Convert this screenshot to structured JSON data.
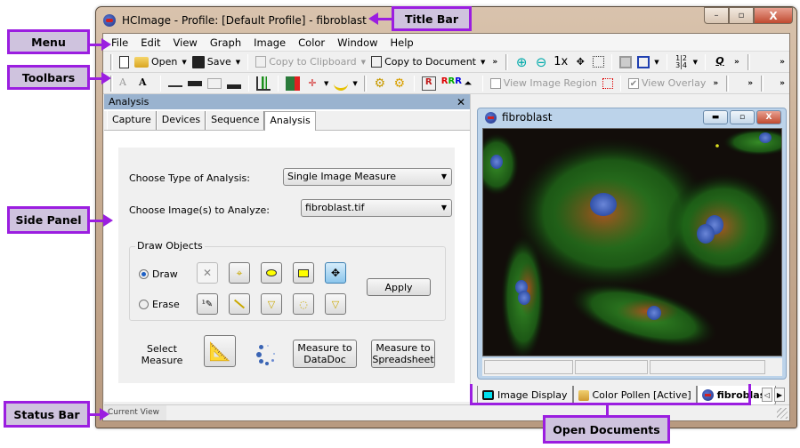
{
  "window": {
    "title": "HCImage - Profile: [Default Profile] - fibroblast",
    "controls": {
      "minimize": "–",
      "maximize": "▫",
      "close": "X"
    }
  },
  "menu": [
    "File",
    "Edit",
    "View",
    "Graph",
    "Image",
    "Color",
    "Window",
    "Help"
  ],
  "toolbar1": {
    "open": "Open",
    "save": "Save",
    "copy_clipboard": "Copy to Clipboard",
    "copy_document": "Copy to Document",
    "zoom_1x": "1x",
    "more": "»"
  },
  "toolbar2": {
    "view_image_region": "View Image Region",
    "view_image_region_checked": false,
    "view_overlay": "View Overlay",
    "view_overlay_checked": true,
    "more": "»"
  },
  "side_panel": {
    "title": "Analysis",
    "close": "✕",
    "tabs": [
      "Capture",
      "Devices",
      "Sequence",
      "Analysis"
    ],
    "active_tab": "Analysis",
    "type_label": "Choose Type of Analysis:",
    "type_value": "Single Image Measure",
    "image_label": "Choose Image(s) to Analyze:",
    "image_value": "fibroblast.tif",
    "draw_group": "Draw Objects",
    "draw_label": "Draw",
    "erase_label": "Erase",
    "draw_selected": true,
    "apply": "Apply",
    "select_measure": "Select Measure",
    "measure_datadoc": "Measure to DataDoc",
    "measure_spreadsheet": "Measure to Spreadsheet"
  },
  "document": {
    "title": "fibroblast"
  },
  "doc_tabs": [
    {
      "label": "Image Display",
      "icon": "monitor-icon",
      "active": false
    },
    {
      "label": "Color Pollen [Active]",
      "icon": "image-doc-icon",
      "active": false
    },
    {
      "label": "fibroblast",
      "icon": "hcimage-icon",
      "active": true
    }
  ],
  "status": {
    "text": "Current View"
  },
  "callouts": {
    "title_bar": "Title Bar",
    "menu": "Menu",
    "toolbars": "Toolbars",
    "side_panel": "Side Panel",
    "status_bar": "Status Bar",
    "open_documents": "Open Documents"
  },
  "colors": {
    "callout_border": "#9b1ee0",
    "callout_fill": "#cfc3de",
    "panel_header": "#9ab3cf"
  }
}
